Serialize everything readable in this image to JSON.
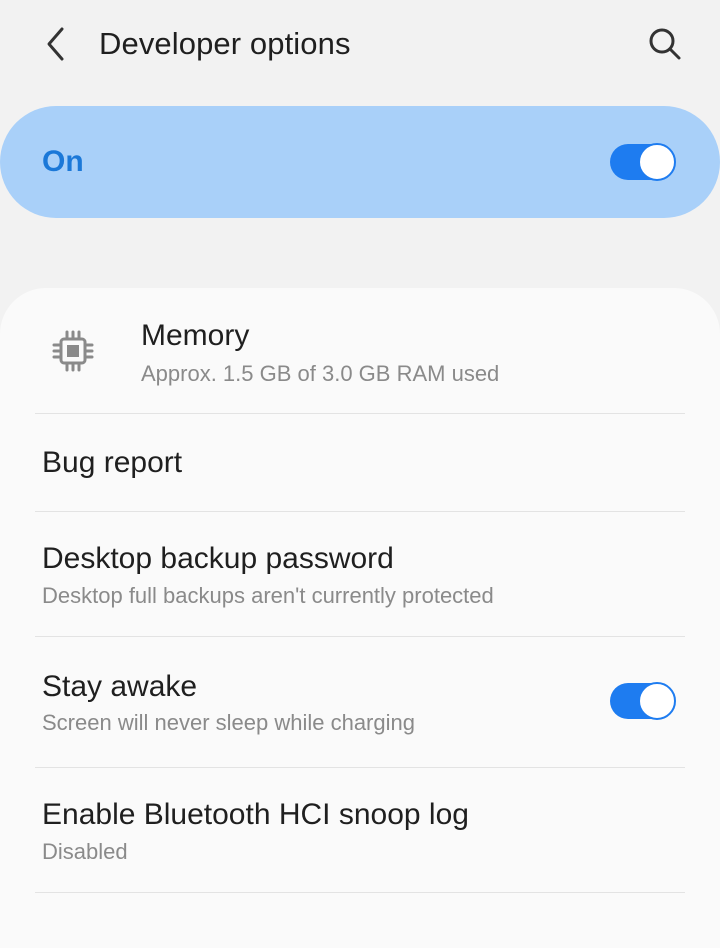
{
  "header": {
    "title": "Developer options",
    "back_icon": "chevron-left-icon",
    "search_icon": "search-icon"
  },
  "master_switch": {
    "label": "On",
    "checked": true
  },
  "settings": {
    "memory": {
      "title": "Memory",
      "subtitle": "Approx. 1.5 GB of 3.0 GB RAM used",
      "icon": "memory-chip-icon"
    },
    "bug_report": {
      "title": "Bug report"
    },
    "desktop_backup": {
      "title": "Desktop backup password",
      "subtitle": "Desktop full backups aren't currently protected"
    },
    "stay_awake": {
      "title": "Stay awake",
      "subtitle": "Screen will never sleep while charging",
      "checked": true
    },
    "bt_hci": {
      "title": "Enable Bluetooth HCI snoop log",
      "subtitle": "Disabled"
    }
  },
  "colors": {
    "accent": "#1e7cf0",
    "master_bg": "#a9d0f9",
    "master_text": "#1b78d8",
    "background": "#f2f2f2",
    "card": "#fafafa"
  }
}
